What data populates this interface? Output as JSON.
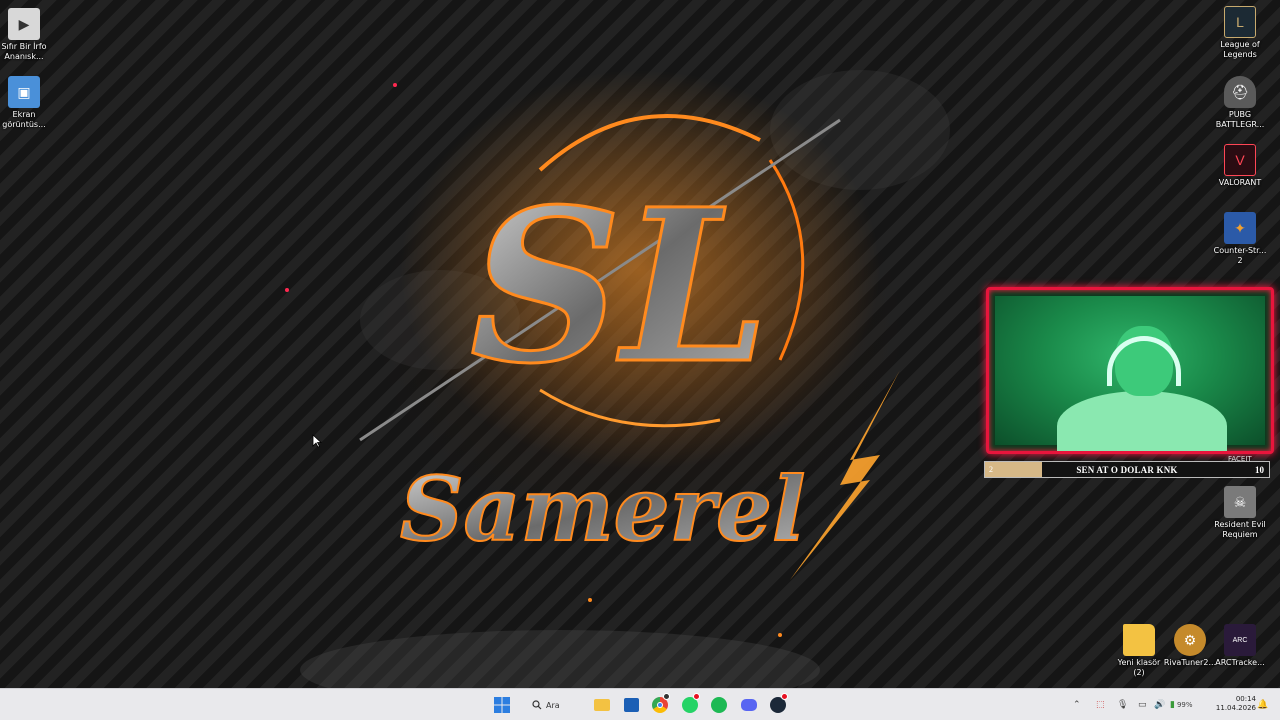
{
  "desktop": {
    "left_icons": [
      {
        "label": "Sıfır Bir İrfo\nAnanısk...",
        "icon": "video-file-icon"
      },
      {
        "label": "Ekran\ngörüntüs...",
        "icon": "image-file-icon"
      }
    ],
    "right_icons": [
      {
        "label": "League of\nLegends",
        "icon": "league-of-legends-icon"
      },
      {
        "label": "PUBG\nBATTLEGR...",
        "icon": "pubg-icon"
      },
      {
        "label": "VALORANT",
        "icon": "valorant-icon"
      },
      {
        "label": "Counter-Str...\n2",
        "icon": "counter-strike-icon"
      },
      {
        "label": "Resident Evil\nRequiem",
        "icon": "resident-evil-icon"
      }
    ],
    "bottom_icons": [
      {
        "label": "Yeni klasör\n(2)",
        "icon": "folder-icon"
      },
      {
        "label": "RivaTuner2...",
        "icon": "rivatuner-icon"
      },
      {
        "label": "ARCTracke...",
        "icon": "arctracker-icon"
      }
    ],
    "wallpaper": {
      "logo_text": "SL",
      "name_text": "Samerel"
    }
  },
  "overlay": {
    "webcam_partial_label": "FACEIT",
    "goal": {
      "current": "2",
      "text": "SEN AT O DOLAR KNK",
      "target": "10",
      "progress": 0.2,
      "fill_color": "#d6b887"
    },
    "frame_color": "#e8153c"
  },
  "taskbar": {
    "search_label": "Ara",
    "apps": [
      "start-icon",
      "search-icon",
      "file-explorer-icon",
      "store-icon",
      "chrome-icon",
      "whatsapp-icon",
      "spotify-icon",
      "discord-icon",
      "steam-icon"
    ],
    "battery": "99%",
    "time": "00:14",
    "date": "11.04.2026"
  },
  "colors": {
    "accent_orange": "#ff8a1e",
    "taskbar_bg": "#e9e9ec"
  }
}
